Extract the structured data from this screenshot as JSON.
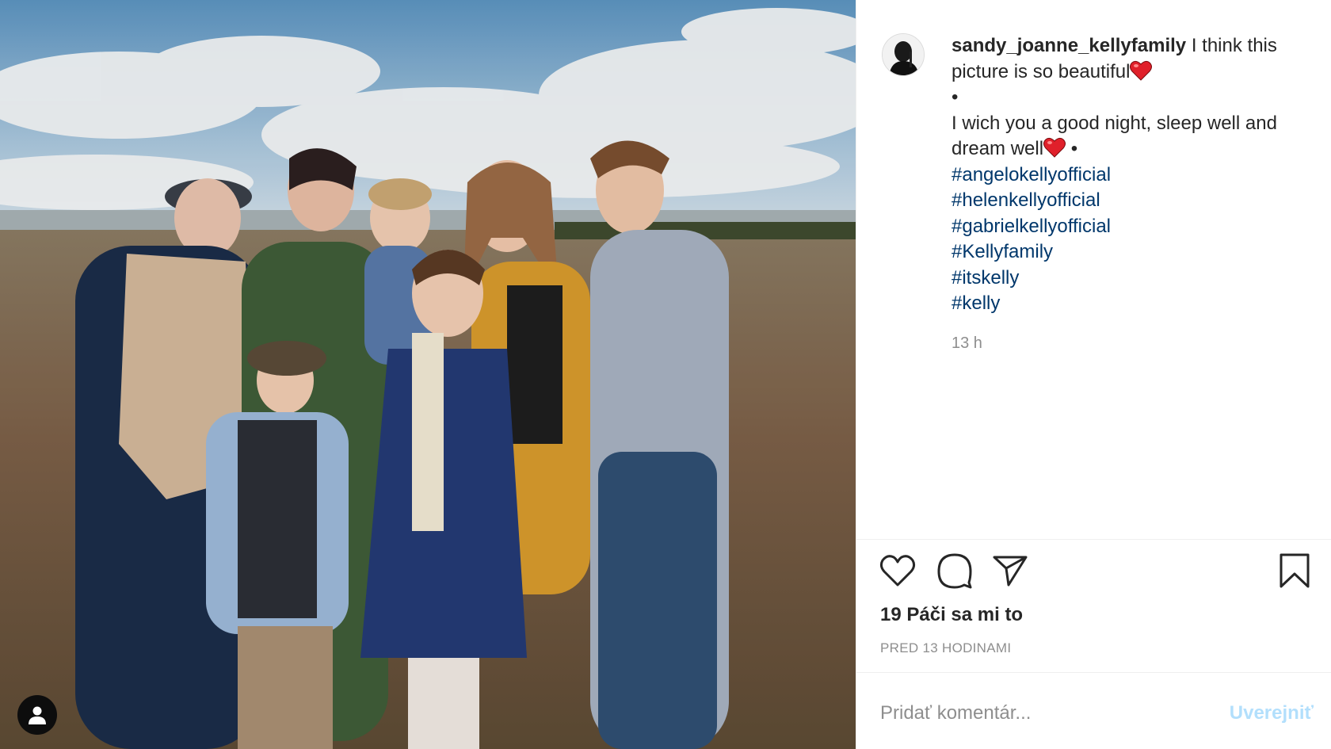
{
  "photo": {
    "alt": "",
    "user_tag_icon": "person-icon"
  },
  "caption": {
    "username": "sandy_joanne_kellyfamily",
    "line1": " I think this picture is so beautiful",
    "bullet": "•",
    "line2": "I wich you a good night, sleep well and dream well",
    "line2_suffix": " •",
    "hashtags": [
      "#angelokellyofficial",
      "#helenkellyofficial",
      "#gabrielkellyofficial",
      "#Kellyfamily",
      "#itskelly",
      "#kelly"
    ],
    "emoji": "heart-emoji",
    "time": "13 h"
  },
  "actions": {
    "like_icon": "heart-outline-icon",
    "comment_icon": "comment-bubble-icon",
    "share_icon": "paper-plane-icon",
    "save_icon": "bookmark-icon"
  },
  "likes": "19 Páči sa mi to",
  "posted_ago": "PRED 13 HODINAMI",
  "comment": {
    "placeholder": "Pridať komentár...",
    "post_label": "Uverejniť"
  },
  "colors": {
    "hashtag": "#00376b",
    "secondary_text": "#8e8e8e",
    "post_button_disabled": "#b2dffc",
    "emoji_heart": "#e0202a"
  }
}
